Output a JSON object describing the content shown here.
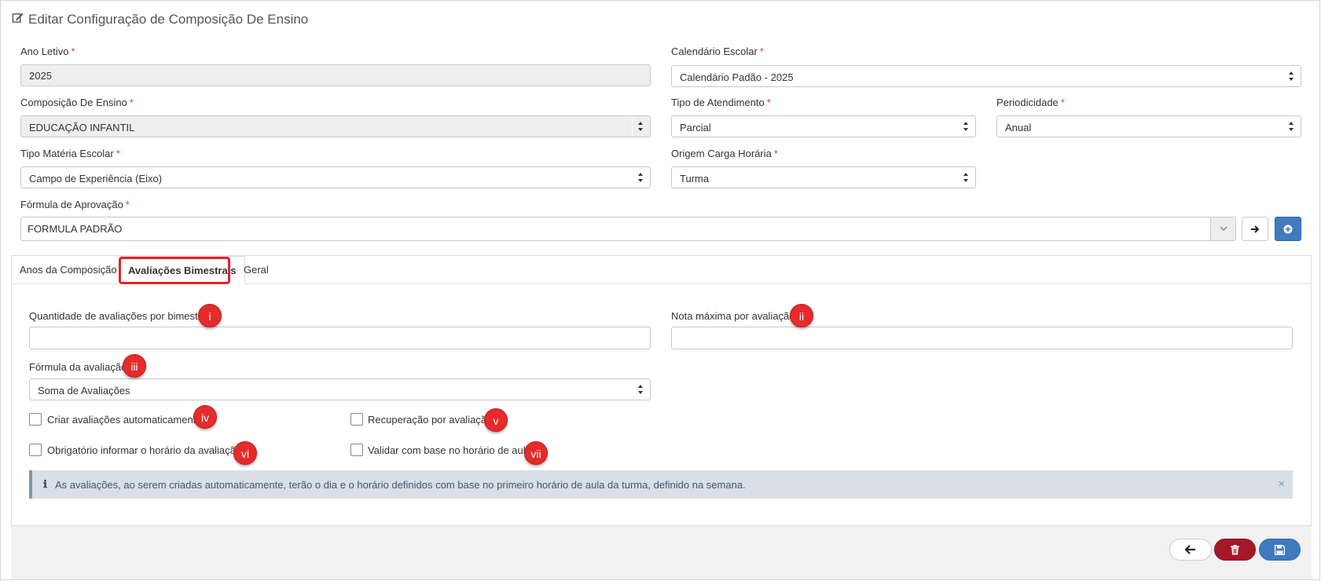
{
  "page": {
    "title": "Editar Configuração de Composição De Ensino"
  },
  "form": {
    "ano_letivo": {
      "label": "Ano Letivo",
      "value": "2025"
    },
    "calendario": {
      "label": "Calendário Escolar",
      "value": "Calendário Padão - 2025"
    },
    "composicao": {
      "label": "Composição De Ensino",
      "value": "EDUCAÇÃO INFANTIL"
    },
    "tipo_atendimento": {
      "label": "Tipo de Atendimento",
      "value": "Parcial"
    },
    "periodicidade": {
      "label": "Periodicidade",
      "value": "Anual"
    },
    "tipo_materia": {
      "label": "Tipo Matéria Escolar",
      "value": "Campo de Experiência (Eixo)"
    },
    "origem_carga": {
      "label": "Origem Carga Horária",
      "value": "Turma"
    },
    "formula_aprovacao": {
      "label": "Fórmula de Aprovação",
      "value": "FORMULA PADRÃO"
    },
    "required_mark": "*"
  },
  "tabs": [
    {
      "label": "Anos da Composição"
    },
    {
      "label": "Avaliações Bimestrais"
    },
    {
      "label": "Geral"
    }
  ],
  "bimestrais": {
    "quantidade_label": "Quantidade de avaliações por bimestre",
    "quantidade_value": "",
    "nota_label": "Nota máxima por avaliação",
    "nota_value": "",
    "formula_label": "Fórmula da avaliação",
    "formula_value": "Soma de Avaliações",
    "checkboxes": [
      {
        "label": "Criar avaliações automaticamente",
        "checked": false
      },
      {
        "label": "Recuperação por avaliação",
        "checked": false
      },
      {
        "label": "Obrigatório informar o horário da avaliação",
        "checked": false
      },
      {
        "label": "Validar com base no horário de aula",
        "checked": false
      }
    ],
    "alert_icon": "ℹ",
    "alert_text": "As avaliações, ao serem criadas automaticamente, terão o dia e o horário definidos com base no primeiro horário de aula da turma, definido na semana.",
    "alert_close": "×"
  },
  "markers": [
    "i",
    "ii",
    "iii",
    "iv",
    "v",
    "vi",
    "vii"
  ],
  "colors": {
    "accent_blue": "#3f7bbd",
    "danger": "#a4182a",
    "marker_red": "#e52b2b",
    "alert_bg": "#d9dfe6"
  },
  "icons": {
    "title": "edit-icon",
    "back": "arrow-left-icon",
    "delete": "trash-icon",
    "save": "save-icon",
    "go": "arrow-right-icon",
    "add": "plus-circle-icon"
  }
}
